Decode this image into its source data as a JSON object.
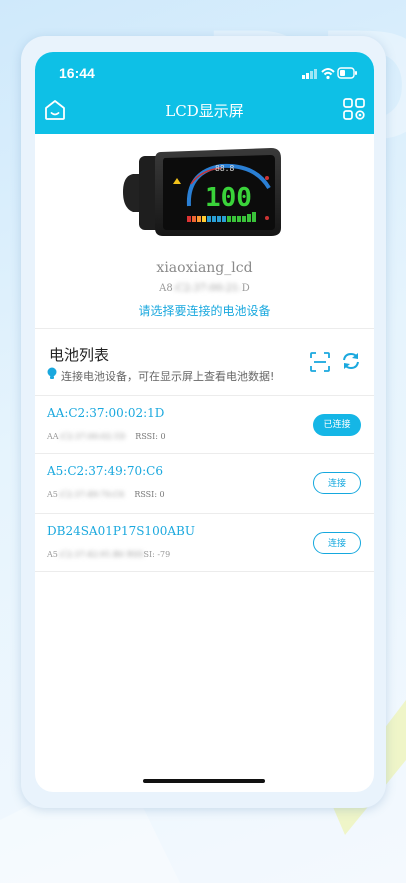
{
  "status_bar": {
    "time": "16:44"
  },
  "header": {
    "title": "LCD显示屏"
  },
  "device": {
    "name": "xiaoxiang_lcd",
    "address_prefix": "A8",
    "address_masked": ":C2:37:00:21:",
    "address_suffix": "D",
    "lcd_value": "100",
    "lcd_small": "88.8"
  },
  "select_prompt": "请选择要连接的电池设备",
  "battery_list": {
    "title": "电池列表",
    "hint": "连接电池设备，可在显示屏上查看电池数据!",
    "items": [
      {
        "name": "AA:C2:37:00:02:1D",
        "mac_prefix": "AA",
        "mac_masked": ":C2:37:00:02:1D",
        "mac_suffix": "",
        "rssi": "RSSI: 0",
        "button": "已连接",
        "state": "connected"
      },
      {
        "name": "A5:C2:37:49:70:C6",
        "mac_prefix": "A5",
        "mac_masked": ":C2:37:49:70:C6",
        "mac_suffix": "",
        "rssi": "RSSI: 0",
        "button": "连接",
        "state": "idle"
      },
      {
        "name": "DB24SA01P17S100ABU",
        "mac_prefix": "A5",
        "mac_masked": ":C2:37:42:91:B0  RSS",
        "mac_suffix": "",
        "rssi": "SI: -79",
        "button": "连接",
        "state": "idle"
      }
    ]
  },
  "colors": {
    "accent": "#0ec0e6",
    "link": "#1aa8de"
  }
}
